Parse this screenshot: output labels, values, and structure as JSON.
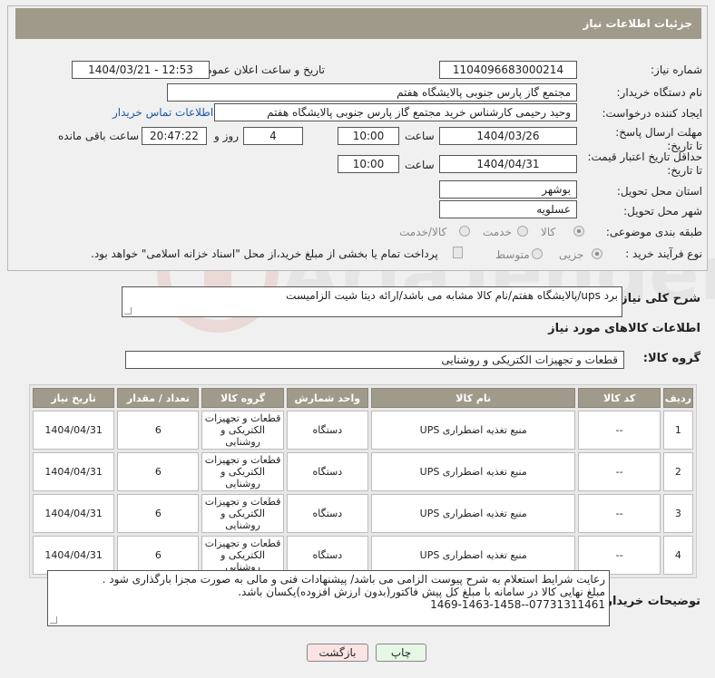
{
  "header": {
    "title": "جزئیات اطلاعات نیاز"
  },
  "form": {
    "need_number_label": "شماره نیاز:",
    "need_number": "1104096683000214",
    "announce_label": "تاریخ و ساعت اعلان عمومی:",
    "announce_value": "1404/03/21 - 12:53",
    "buyer_org_label": "نام دستگاه خریدار:",
    "buyer_org": "مجتمع گاز پارس جنوبی  پالایشگاه هفتم",
    "requester_label": "ایجاد کننده درخواست:",
    "requester": "وحید رحیمی کارشناس خرید مجتمع گاز پارس جنوبی  پالایشگاه هفتم",
    "contact_link": "اطلاعات تماس خریدار",
    "reply_deadline_label": "مهلت ارسال پاسخ: تا تاریخ:",
    "reply_date": "1404/03/26",
    "time_label": "ساعت",
    "reply_time": "10:00",
    "days_value": "4",
    "days_label": "روز و",
    "remaining_time": "20:47:22",
    "remaining_label": "ساعت باقی مانده",
    "validity_label": "حداقل تاریخ اعتبار قیمت: تا تاریخ:",
    "validity_date": "1404/04/31",
    "validity_time": "10:00",
    "province_label": "استان محل تحویل:",
    "province": "بوشهر",
    "city_label": "شهر محل تحویل:",
    "city": "عسلویه",
    "category_label": "طبقه بندی موضوعی:",
    "category_options": [
      "کالا",
      "خدمت",
      "کالا/خدمت"
    ],
    "process_label": "نوع فرآیند خرید :",
    "process_options": [
      "جزیی",
      "متوسط"
    ],
    "payment_note": "پرداخت تمام یا بخشی از مبلغ خرید،از محل \"اسناد خزانه اسلامی\" خواهد بود."
  },
  "description": {
    "label": "شرح کلی نیاز:",
    "text": "برد ups/پالایشگاه هفتم/نام کالا مشابه می باشد/ارائه دیتا شیت الزامیست"
  },
  "goods_section": {
    "title": "اطلاعات کالاهای مورد نیاز",
    "group_label": "گروه کالا:",
    "group_value": "قطعات و تجهیزات الکتریکی و روشنایی"
  },
  "table": {
    "headers": [
      "ردیف",
      "کد کالا",
      "نام کالا",
      "واحد شمارش",
      "گروه کالا",
      "تعداد / مقدار",
      "تاریخ نیاز"
    ],
    "rows": [
      [
        "1",
        "--",
        "منبع تغذیه اضطراری UPS",
        "دستگاه",
        "قطعات و تجهیزات الکتریکی و روشنایی",
        "6",
        "1404/04/31"
      ],
      [
        "2",
        "--",
        "منبع تغذیه اضطراری UPS",
        "دستگاه",
        "قطعات و تجهیزات الکتریکی و روشنایی",
        "6",
        "1404/04/31"
      ],
      [
        "3",
        "--",
        "منبع تغذیه اضطراری UPS",
        "دستگاه",
        "قطعات و تجهیزات الکتریکی و روشنایی",
        "6",
        "1404/04/31"
      ],
      [
        "4",
        "--",
        "منبع تغذیه اضطراری UPS",
        "دستگاه",
        "قطعات و تجهیزات الکتریکی و روشنایی",
        "6",
        "1404/04/31"
      ]
    ]
  },
  "buyer_notes": {
    "label": "توضیحات خریدار:",
    "line1": "رعایت شرایط استعلام به شرح پیوست الزامی می باشد/ پیشنهادات فنی و مالی به صورت مجزا بارگذاری شود .",
    "line2": "مبلغ نهایی کالا در سامانه با مبلغ کل پیش فاکتور(بدون ارزش افزوده)یکسان باشد.",
    "line3": "07731311461--1469-1463-1458"
  },
  "buttons": {
    "print": "چاپ",
    "back": "بازگشت"
  },
  "watermark": {
    "text": "AriaTender.net"
  },
  "colors": {
    "header_bg": "#a09a8a",
    "link": "#1a5aa8",
    "print_btn": "#e6f7e6",
    "back_btn": "#fbe3e3"
  }
}
